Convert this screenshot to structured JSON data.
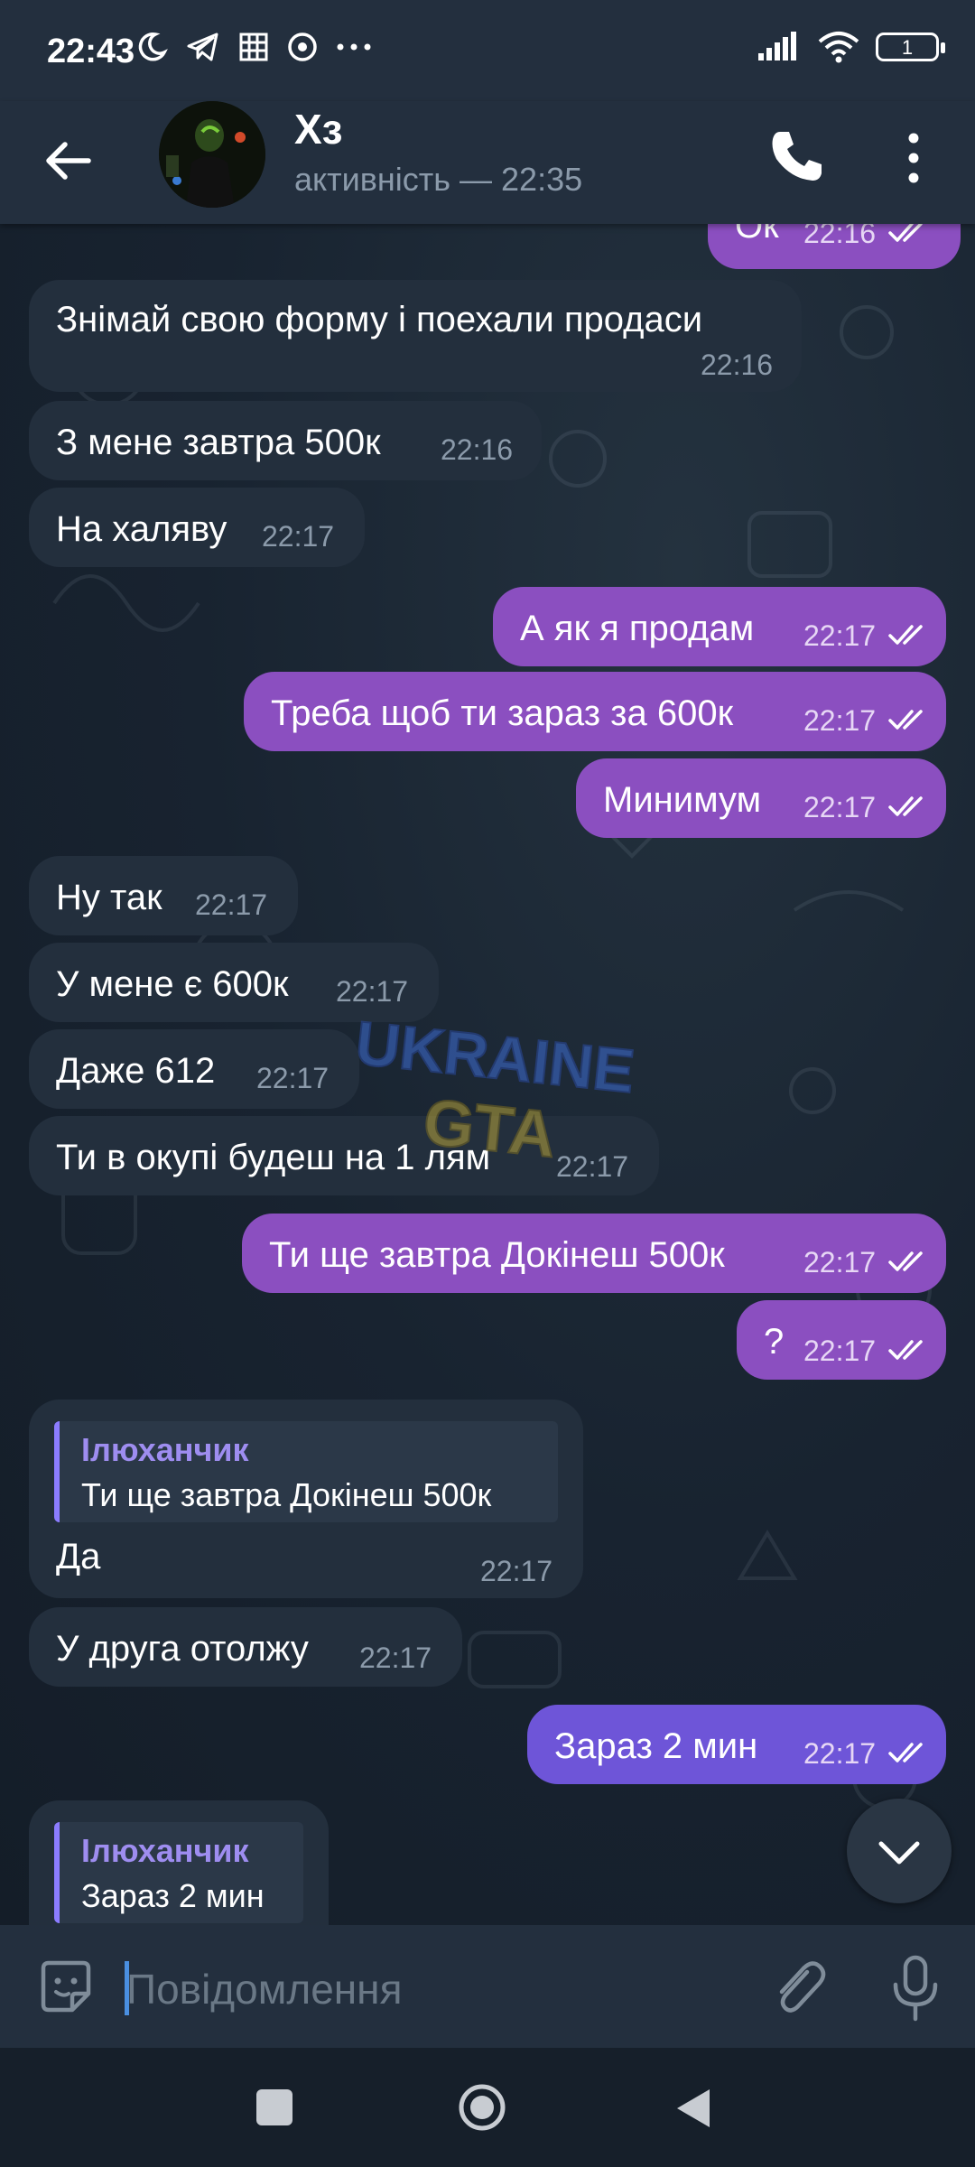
{
  "status": {
    "time": "22:43",
    "battery": "1"
  },
  "header": {
    "name": "Хз",
    "status": "активність — 22:35"
  },
  "messages": [
    {
      "dir": "out",
      "text": "Ок",
      "time": "22:16"
    },
    {
      "dir": "in",
      "text": "Знімай свою форму і поехали продаси",
      "time": "22:16"
    },
    {
      "dir": "in",
      "text": "З мене завтра 500к",
      "time": "22:16"
    },
    {
      "dir": "in",
      "text": "На халяву",
      "time": "22:17"
    },
    {
      "dir": "out",
      "text": "А як я продам",
      "time": "22:17"
    },
    {
      "dir": "out",
      "text": "Треба щоб ти зараз за 600к",
      "time": "22:17"
    },
    {
      "dir": "out",
      "text": "Минимум",
      "time": "22:17"
    },
    {
      "dir": "in",
      "text": "Ну так",
      "time": "22:17"
    },
    {
      "dir": "in",
      "text": "У мене є 600к",
      "time": "22:17"
    },
    {
      "dir": "in",
      "text": "Даже 612",
      "time": "22:17"
    },
    {
      "dir": "in",
      "text": "Ти в окупі будеш на 1 лям",
      "time": "22:17"
    },
    {
      "dir": "out",
      "text": "Ти ще завтра Докінеш 500к",
      "time": "22:17"
    },
    {
      "dir": "out",
      "text": "?",
      "time": "22:17"
    },
    {
      "dir": "in",
      "reply_name": "Ілюханчик",
      "reply_text": "Ти ще завтра Докінеш 500к",
      "text": "Да",
      "time": "22:17"
    },
    {
      "dir": "in",
      "text": "У друга отолжу",
      "time": "22:17"
    },
    {
      "dir": "out",
      "text": "Зараз 2 мин",
      "time": "22:17"
    },
    {
      "dir": "in",
      "reply_name": "Ілюханчик",
      "reply_text": "Зараз 2 мин"
    }
  ],
  "watermark": {
    "line1": "UKRAINE",
    "line2": "GTA"
  },
  "input": {
    "placeholder": "Повідомлення"
  },
  "icons": {
    "back": "arrow-left-icon",
    "call": "phone-icon",
    "more": "more-vertical-icon",
    "emoji": "sticker-icon",
    "attach": "paperclip-icon",
    "mic": "microphone-icon",
    "scroll": "chevron-down-icon",
    "read": "double-check-icon"
  },
  "colors": {
    "outgoing": "#8b4fc0",
    "outgoing_last": "#6e55d8",
    "incoming": "#232f3d",
    "reply_accent": "#8b7cff"
  }
}
